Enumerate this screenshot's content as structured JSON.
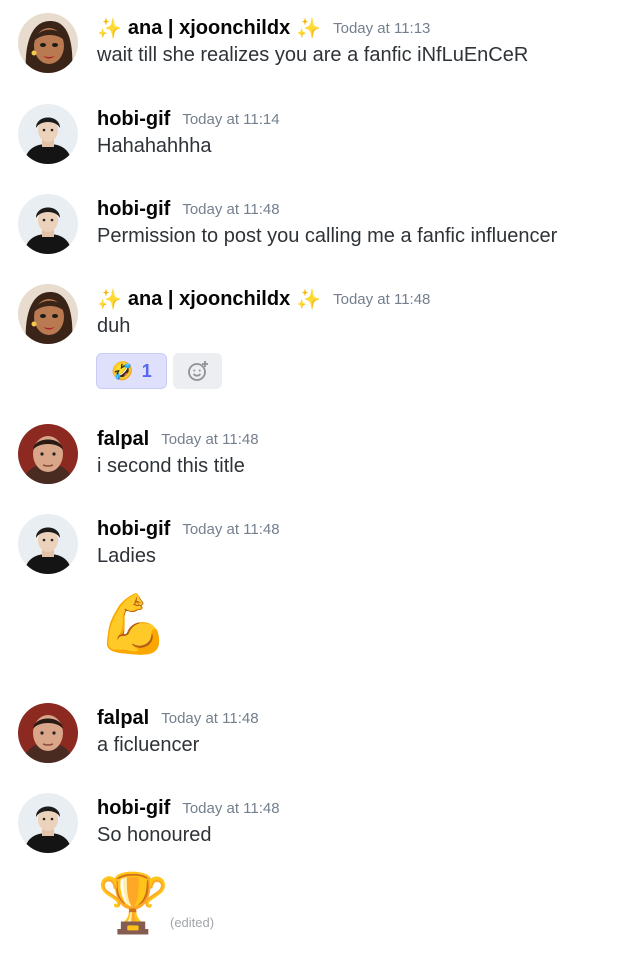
{
  "colors": {
    "accent": "#5865f2",
    "timestamp": "#747f8d",
    "text": "#2e3338",
    "username": "#060607"
  },
  "messages": [
    {
      "author": "ana | xjoonchildx",
      "sparkles": "✨",
      "time": "Today at 11:13",
      "text": "wait till she realizes you are a fanfic iNfLuEnCeR",
      "avatar": "illustrated-woman-avatar"
    },
    {
      "author": "hobi-gif",
      "time": "Today at 11:14",
      "text": "Hahahahhha",
      "avatar": "man-black-outfit-avatar"
    },
    {
      "author": "hobi-gif",
      "time": "Today at 11:48",
      "text": "Permission to post you calling me a fanfic influencer",
      "avatar": "man-black-outfit-avatar"
    },
    {
      "author": "ana | xjoonchildx",
      "sparkles": "✨",
      "time": "Today at 11:48",
      "text": "duh",
      "avatar": "illustrated-woman-avatar",
      "reactions": [
        {
          "emoji": "🤣",
          "count": "1",
          "active": true
        },
        {
          "emoji": "add-reaction-icon"
        }
      ]
    },
    {
      "author": "falpal",
      "time": "Today at 11:48",
      "text": "i second this title",
      "avatar": "man-red-background-avatar"
    },
    {
      "author": "hobi-gif",
      "time": "Today at 11:48",
      "text": "Ladies",
      "avatar": "man-black-outfit-avatar",
      "big_emoji": "💪"
    },
    {
      "author": "falpal",
      "time": "Today at 11:48",
      "text": "a ficluencer",
      "avatar": "man-red-background-avatar"
    },
    {
      "author": "hobi-gif",
      "time": "Today at 11:48",
      "text": "So honoured",
      "avatar": "man-black-outfit-avatar",
      "big_emoji": "🏆",
      "edited_label": "(edited)"
    }
  ]
}
